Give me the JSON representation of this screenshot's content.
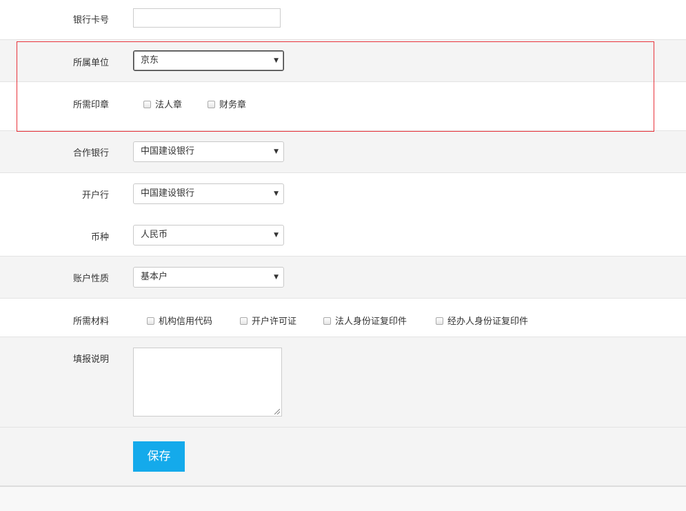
{
  "fields": {
    "bank_card": {
      "label": "银行卡号",
      "value": ""
    },
    "unit": {
      "label": "所属单位",
      "value": "京东"
    },
    "seal": {
      "label": "所需印章",
      "options": [
        "法人章",
        "财务章"
      ]
    },
    "coop_bank": {
      "label": "合作银行",
      "value": "中国建设银行"
    },
    "open_bank": {
      "label": "开户行",
      "value": "中国建设银行"
    },
    "currency": {
      "label": "币种",
      "value": "人民币"
    },
    "account_type": {
      "label": "账户性质",
      "value": "基本户"
    },
    "materials": {
      "label": "所需材料",
      "options": [
        "机构信用代码",
        "开户许可证",
        "法人身份证复印件",
        "经办人身份证复印件"
      ]
    },
    "notes": {
      "label": "填报说明",
      "value": ""
    }
  },
  "save_label": "保存",
  "caret_glyph": "▼",
  "colors": {
    "accent": "#14aaeb",
    "highlight_border": "#e8323a",
    "row_gray": "#f4f4f4"
  }
}
